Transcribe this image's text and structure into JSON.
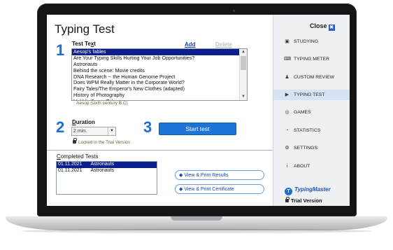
{
  "window": {
    "title": "Typing Test"
  },
  "links": {
    "add": "Add",
    "delete": "Delete"
  },
  "steps": {
    "one": "1",
    "two": "2",
    "three": "3"
  },
  "test_text": {
    "label_prefix": "Test Te",
    "label_accel": "x",
    "label_suffix": "t",
    "items": [
      "Aesop's fables",
      "Are Your Typing Skills Hurting Your Job Opportunities?",
      "Astronauts",
      "Behind the scene: Movie credits",
      "DNA Research -- the Human Genome Project",
      "Does WPM Really Matter in the Corporate World?",
      "Fairy Tales/The Emperor's New Clothes (adapted)",
      "History of Photography",
      "Hubble Space Telescope"
    ],
    "selected_index": 0,
    "author": "Aesop (sixth century B.C)"
  },
  "duration": {
    "label_accel": "D",
    "label_rest": "uration",
    "value": "2 min.",
    "locked_text": "Locked in the Trial Version"
  },
  "start_button": "Start test",
  "completed": {
    "label_prefix": "",
    "label_accel": "C",
    "label_rest": "ompleted Tests",
    "rows": [
      {
        "date": "01.11.2021",
        "name": "Astronauts"
      },
      {
        "date": "01.11.2021",
        "name": "Astronauts"
      }
    ],
    "selected_index": 0
  },
  "buttons": {
    "view_results": "View & Print Results",
    "view_certificate": "View & Print Certificate"
  },
  "sidebar": {
    "close_label": "Close",
    "close_icon": "✖",
    "items": [
      {
        "label": "STUDYING",
        "icon": "briefcase-icon",
        "glyph": "▣"
      },
      {
        "label": "TYPING METER",
        "icon": "keyboard-icon",
        "glyph": "⌨"
      },
      {
        "label": "CUSTOM REVIEW",
        "icon": "person-icon",
        "glyph": "♟"
      },
      {
        "label": "TYPING TEST",
        "icon": "play-circle-icon",
        "glyph": "▶"
      },
      {
        "label": "GAMES",
        "icon": "globe-icon",
        "glyph": "◎"
      },
      {
        "label": "STATISTICS",
        "icon": "pie-chart-icon",
        "glyph": "◔"
      },
      {
        "label": "SETTINGS",
        "icon": "gear-icon",
        "glyph": "⚙"
      },
      {
        "label": "ABOUT",
        "icon": "info-icon",
        "glyph": "i"
      }
    ],
    "active_index": 3,
    "brand": "TypingMaster",
    "brand_glyph": "T",
    "trial_label": "Trial Version"
  },
  "colors": {
    "accent": "#1d74d6",
    "selection": "#0a1e8c",
    "sidebar_bg": "#eef0f4"
  }
}
